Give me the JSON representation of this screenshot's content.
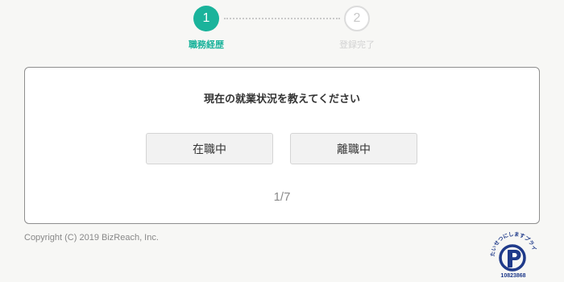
{
  "stepper": {
    "steps": [
      {
        "number": "1",
        "label": "職務経歴"
      },
      {
        "number": "2",
        "label": "登録完了"
      }
    ]
  },
  "question": {
    "title": "現在の就業状況を教えてください",
    "options": [
      "在職中",
      "離職中"
    ],
    "progress": "1/7"
  },
  "footer": {
    "copyright": "Copyright (C) 2019 BizReach, Inc.",
    "privacy_mark": {
      "text": "たいせつにしますプライバシー",
      "number": "10823868"
    }
  },
  "colors": {
    "accent": "#1ab39b",
    "inactive": "#dcdcdc",
    "background": "#f7f7f5",
    "privacy_mark": "#1f3a8a"
  }
}
